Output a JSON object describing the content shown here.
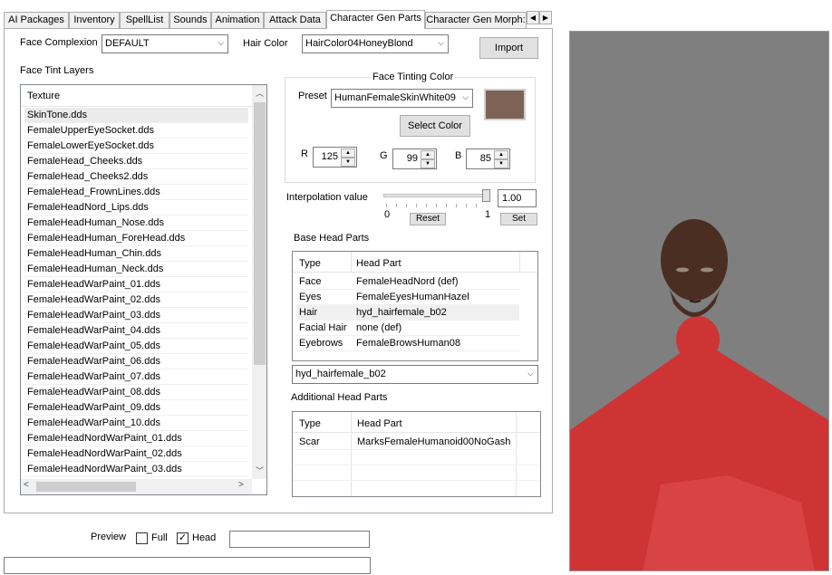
{
  "tabs": [
    "AI Packages",
    "Inventory",
    "SpellList",
    "Sounds",
    "Animation",
    "Attack Data",
    "Character Gen Parts",
    "Character Gen Morph:"
  ],
  "active_tab": 6,
  "face_complexion": {
    "label": "Face Complexion",
    "value": "DEFAULT"
  },
  "hair_color": {
    "label": "Hair Color",
    "value": "HairColor04HoneyBlond"
  },
  "import_label": "Import",
  "face_tint_layers": {
    "label": "Face Tint Layers",
    "column": "Texture",
    "items": [
      "SkinTone.dds",
      "FemaleUpperEyeSocket.dds",
      "FemaleLowerEyeSocket.dds",
      "FemaleHead_Cheeks.dds",
      "FemaleHead_Cheeks2.dds",
      "FemaleHead_FrownLines.dds",
      "FemaleHeadNord_Lips.dds",
      "FemaleHeadHuman_Nose.dds",
      "FemaleHeadHuman_ForeHead.dds",
      "FemaleHeadHuman_Chin.dds",
      "FemaleHeadHuman_Neck.dds",
      "FemaleHeadWarPaint_01.dds",
      "FemaleHeadWarPaint_02.dds",
      "FemaleHeadWarPaint_03.dds",
      "FemaleHeadWarPaint_04.dds",
      "FemaleHeadWarPaint_05.dds",
      "FemaleHeadWarPaint_06.dds",
      "FemaleHeadWarPaint_07.dds",
      "FemaleHeadWarPaint_08.dds",
      "FemaleHeadWarPaint_09.dds",
      "FemaleHeadWarPaint_10.dds",
      "FemaleHeadNordWarPaint_01.dds",
      "FemaleHeadNordWarPaint_02.dds",
      "FemaleHeadNordWarPaint_03.dds"
    ],
    "selected": 0
  },
  "face_tinting": {
    "title": "Face Tinting Color",
    "preset_label": "Preset",
    "preset_value": "HumanFemaleSkinWhite09",
    "swatch_color": "#7d6355",
    "select_color_label": "Select Color",
    "r_label": "R",
    "r": "125",
    "g_label": "G",
    "g": "99",
    "b_label": "B",
    "b": "85"
  },
  "interpolation": {
    "label": "Interpolation value",
    "min": "0",
    "max": "1",
    "value": "1.00",
    "level": 1.0,
    "reset_label": "Reset",
    "set_label": "Set"
  },
  "base_head_parts": {
    "label": "Base Head Parts",
    "col_type": "Type",
    "col_part": "Head Part",
    "rows": [
      {
        "type": "Face",
        "part": "FemaleHeadNord (def)"
      },
      {
        "type": "Eyes",
        "part": "FemaleEyesHumanHazel"
      },
      {
        "type": "Hair",
        "part": "hyd_hairfemale_b02"
      },
      {
        "type": "Facial Hair",
        "part": "none (def)"
      },
      {
        "type": "Eyebrows",
        "part": "FemaleBrowsHuman08"
      }
    ],
    "selected": 2,
    "combo_value": "hyd_hairfemale_b02"
  },
  "additional_head_parts": {
    "label": "Additional Head Parts",
    "col_type": "Type",
    "col_part": "Head Part",
    "rows": [
      {
        "type": "Scar",
        "part": "MarksFemaleHumanoid00NoGash"
      }
    ]
  },
  "preview": {
    "label": "Preview",
    "full_label": "Full",
    "full_checked": false,
    "head_label": "Head",
    "head_checked": true
  },
  "check_mark": "✓",
  "colors": {
    "viewport_bg": "#7f7f7f",
    "body_red": "#cf3434",
    "skin": "#4a2e22"
  }
}
